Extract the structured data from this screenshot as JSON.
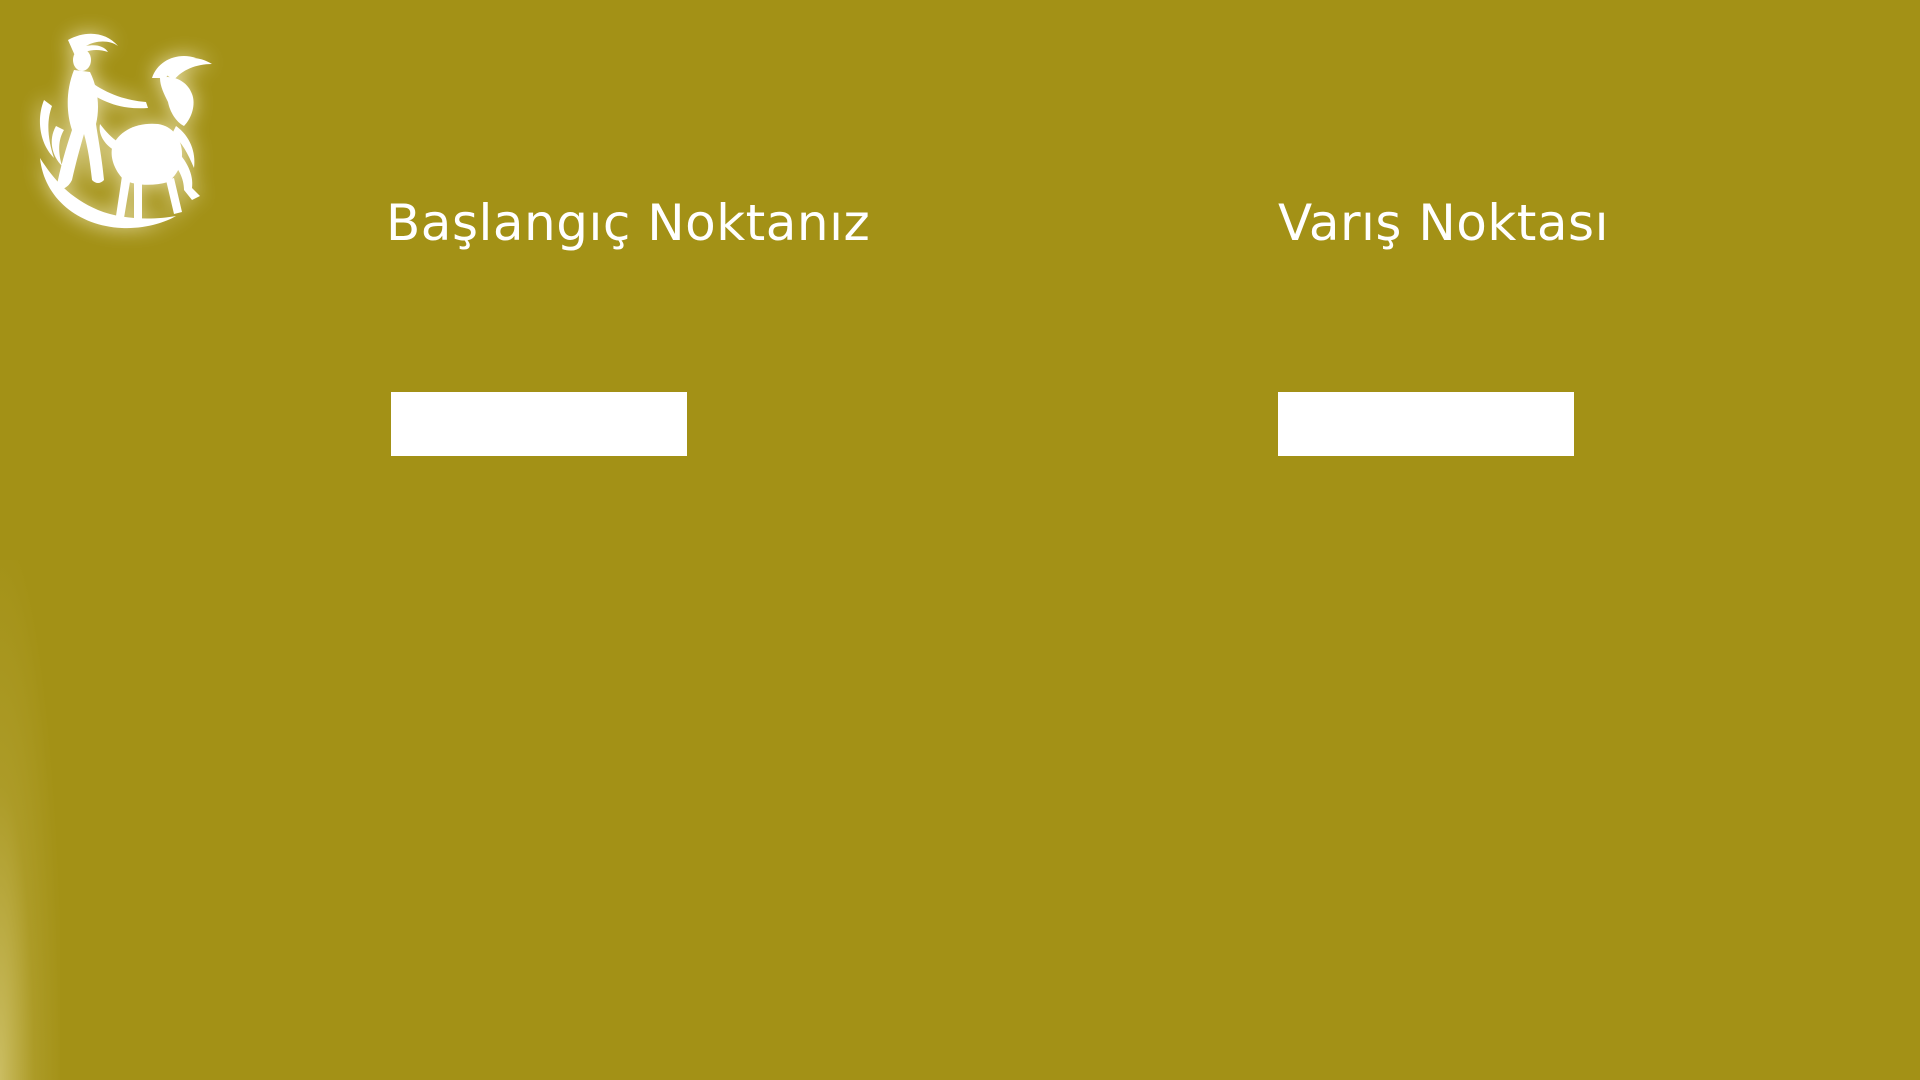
{
  "theme": {
    "background": "#a39116",
    "text": "#ffffff",
    "input_background": "#ffffff"
  },
  "logo": {
    "icon": "maiden-and-goat-emblem-icon"
  },
  "start": {
    "label": "Başlangıç Noktanız",
    "value": ""
  },
  "destination": {
    "label": "Varış Noktası",
    "value": ""
  }
}
